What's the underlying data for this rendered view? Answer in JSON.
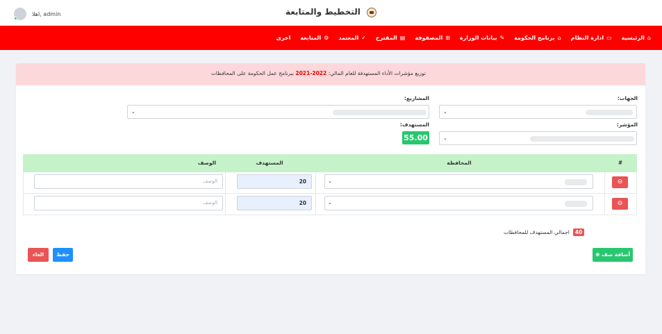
{
  "header": {
    "app_title": "التخطيط والمتابعة",
    "greeting": "اهلا, admin",
    "logo_icon": "emblem-icon",
    "avatar_icon": "user-avatar-icon"
  },
  "nav": {
    "items": [
      {
        "label": "الرئيسية",
        "icon": "home-icon",
        "glyph": "⌂"
      },
      {
        "label": "ادارة النظام",
        "icon": "monitor-icon",
        "glyph": "▭"
      },
      {
        "label": "برنامج الحكومة",
        "icon": "bank-icon",
        "glyph": "⌂"
      },
      {
        "label": "بيانات الوزارة",
        "icon": "edit-icon",
        "glyph": "✎"
      },
      {
        "label": "المصفوفة",
        "icon": "grid-icon",
        "glyph": "⊞"
      },
      {
        "label": "المقترح",
        "icon": "form-icon",
        "glyph": "▤"
      },
      {
        "label": "المعتمد",
        "icon": "check-icon",
        "glyph": "✓"
      },
      {
        "label": "المتابعة",
        "icon": "cogs-icon",
        "glyph": "⚙"
      },
      {
        "label": "اخرى",
        "icon": "",
        "glyph": ""
      }
    ]
  },
  "alert": {
    "text_before": "توزيع مؤشرات الأداء المستهدفة للعام المالي: ",
    "year": "2022-2021",
    "text_after": " ببرنامج عمل الحكومة على المحافظات"
  },
  "form": {
    "entities_label": "الجهات:",
    "projects_label": "المشاريع:",
    "indicator_label": "المؤشر:",
    "target_label": "المستهدف:",
    "target_value": "55.00"
  },
  "table": {
    "headers": {
      "index": "#",
      "governorate": "المحافظة",
      "target": "المستهدف",
      "description": "الوصف"
    },
    "rows": [
      {
        "target": "20",
        "description_placeholder": "الوصف"
      },
      {
        "target": "20",
        "description_placeholder": "الوصف"
      }
    ]
  },
  "summary": {
    "total_label": "اجمالي المستهدف للمحافظات",
    "total_value": "40"
  },
  "buttons": {
    "add_row": "أضافة صف",
    "save": "حفظ",
    "cancel": "الغاء"
  },
  "colors": {
    "nav_bg": "#ff0000",
    "alert_bg": "#fdd8da",
    "table_header_bg": "#c6f2c9",
    "success": "#28c76f",
    "danger": "#ea5455",
    "primary": "#1e90ff"
  }
}
